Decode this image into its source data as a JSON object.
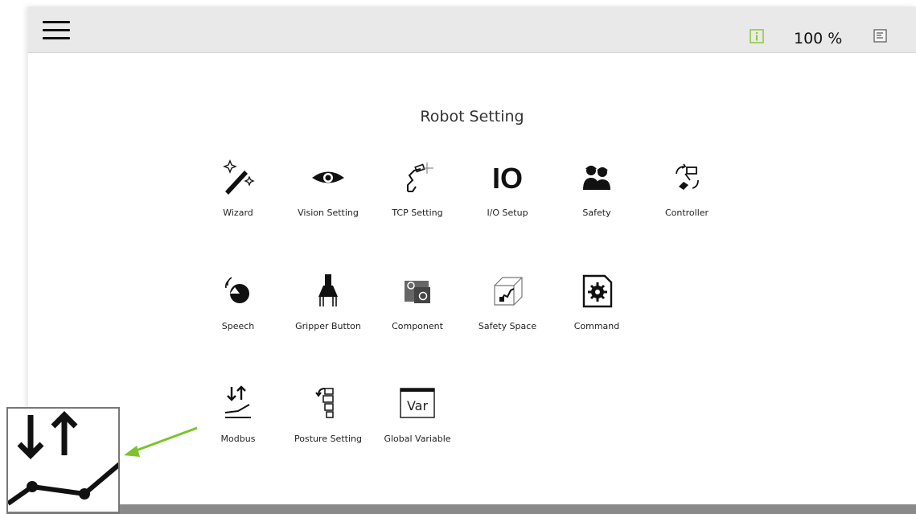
{
  "topbar": {
    "menu_icon": "hamburger-menu-icon",
    "info_icon": "info-icon",
    "info_color": "#8dc63f",
    "zoom_level": "100 %",
    "doc_icon": "document-icon"
  },
  "page": {
    "title": "Robot Setting"
  },
  "tiles": [
    {
      "label": "Wizard",
      "icon": "wizard-wand-icon"
    },
    {
      "label": "Vision Setting",
      "icon": "eye-icon"
    },
    {
      "label": "TCP Setting",
      "icon": "tcp-tool-icon"
    },
    {
      "label": "I/O Setup",
      "icon": "io-icon"
    },
    {
      "label": "Safety",
      "icon": "safety-people-icon"
    },
    {
      "label": "Controller",
      "icon": "controller-icon"
    },
    {
      "label": "Speech",
      "icon": "speech-icon"
    },
    {
      "label": "Gripper Button",
      "icon": "gripper-icon"
    },
    {
      "label": "Component",
      "icon": "component-icon"
    },
    {
      "label": "Safety Space",
      "icon": "safety-space-icon"
    },
    {
      "label": "Command",
      "icon": "command-gear-icon"
    },
    {
      "label": "Modbus",
      "icon": "modbus-icon"
    },
    {
      "label": "Posture Setting",
      "icon": "posture-icon"
    },
    {
      "label": "Global Variable",
      "icon": "global-variable-icon"
    }
  ],
  "callout": {
    "icon": "modbus-icon",
    "arrow_color": "#7cc42a"
  },
  "io_text": "IO",
  "var_text": "Var"
}
